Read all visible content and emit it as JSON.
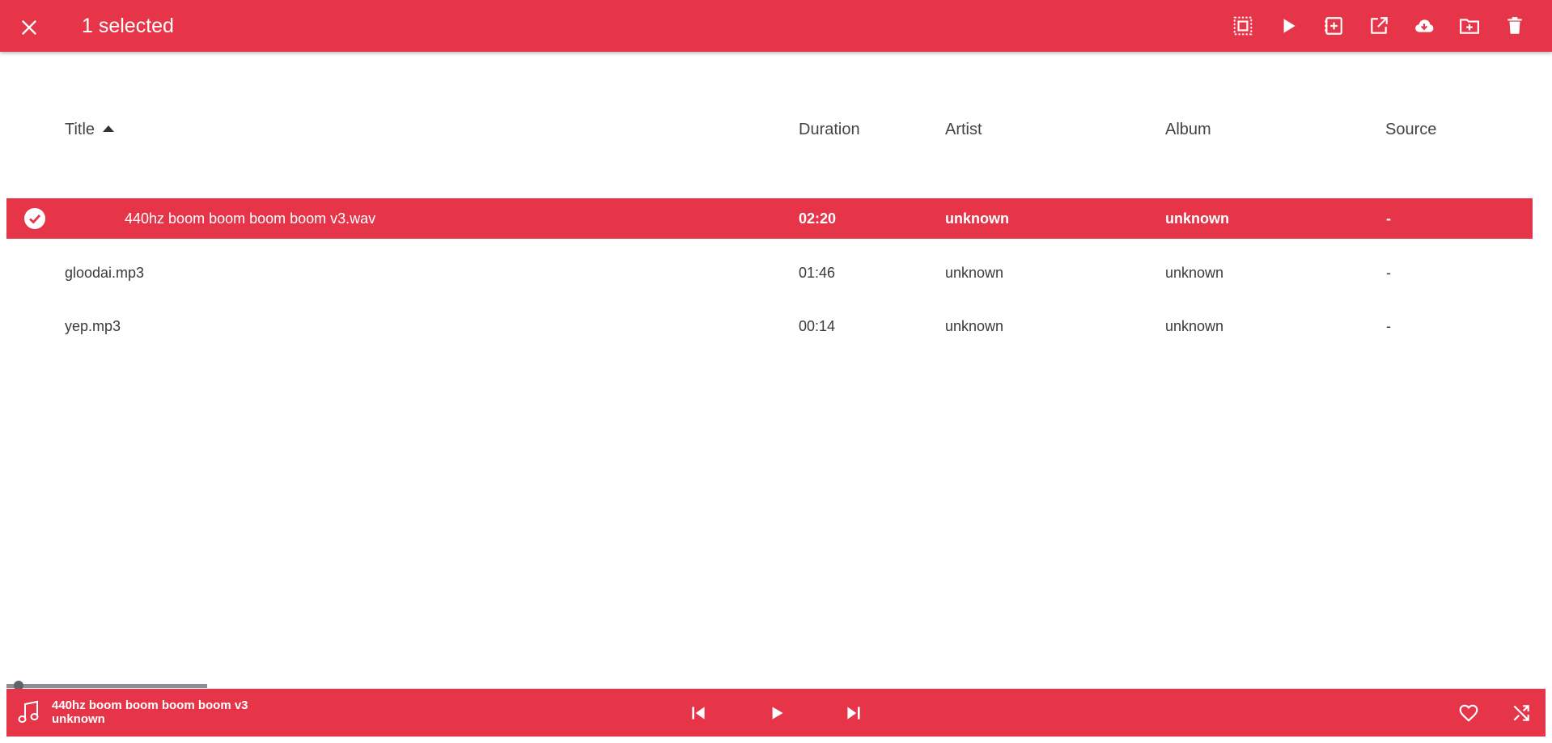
{
  "header": {
    "selection_label": "1 selected",
    "background_color": "#e63549",
    "actions": [
      {
        "name": "select-all-icon"
      },
      {
        "name": "play-icon"
      },
      {
        "name": "add-to-queue-icon"
      },
      {
        "name": "open-external-icon"
      },
      {
        "name": "cloud-download-icon"
      },
      {
        "name": "add-to-folder-icon"
      },
      {
        "name": "delete-icon"
      }
    ]
  },
  "table": {
    "columns": {
      "title": "Title",
      "duration": "Duration",
      "artist": "Artist",
      "album": "Album",
      "source": "Source"
    },
    "sort": {
      "column": "Title",
      "direction": "ascending"
    },
    "rows": [
      {
        "title": "440hz boom boom boom boom v3.wav",
        "duration": "02:20",
        "artist": "unknown",
        "album": "unknown",
        "source": "-",
        "selected": true
      },
      {
        "title": "gloodai.mp3",
        "duration": "01:46",
        "artist": "unknown",
        "album": "unknown",
        "source": "-",
        "selected": false
      },
      {
        "title": "yep.mp3",
        "duration": "00:14",
        "artist": "unknown",
        "album": "unknown",
        "source": "-",
        "selected": false
      }
    ]
  },
  "player": {
    "now_playing_title": "440hz boom boom boom boom v3",
    "now_playing_artist": "unknown",
    "progress_fraction": 0.06,
    "controls": [
      "previous-icon",
      "play-icon",
      "next-icon"
    ],
    "extra": [
      "heart-icon",
      "shuffle-icon"
    ]
  }
}
